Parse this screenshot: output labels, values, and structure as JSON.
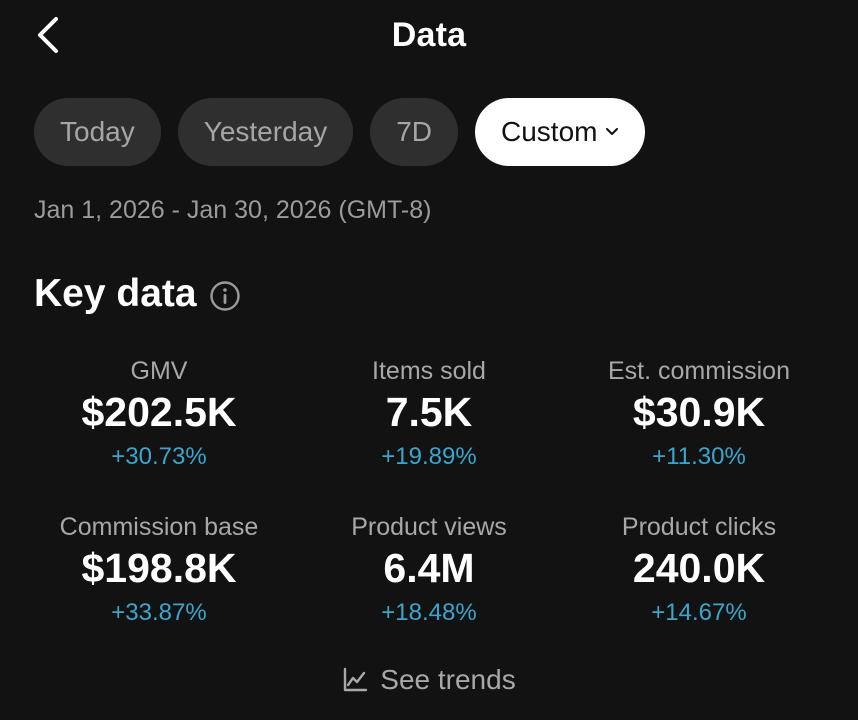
{
  "header": {
    "title": "Data",
    "back_icon": "chevron-left-icon"
  },
  "tabs": [
    {
      "label": "Today",
      "active": false
    },
    {
      "label": "Yesterday",
      "active": false
    },
    {
      "label": "7D",
      "active": false
    },
    {
      "label": "Custom",
      "active": true,
      "icon": "chevron-down-icon"
    }
  ],
  "date_range": "Jan 1, 2026 - Jan 30, 2026 (GMT-8)",
  "key_data": {
    "title": "Key data",
    "info_icon": "info-circle-icon",
    "metrics": [
      {
        "label": "GMV",
        "value": "$202.5K",
        "change": "+30.73%"
      },
      {
        "label": "Items sold",
        "value": "7.5K",
        "change": "+19.89%"
      },
      {
        "label": "Est. commission",
        "value": "$30.9K",
        "change": "+11.30%"
      },
      {
        "label": "Commission base",
        "value": "$198.8K",
        "change": "+33.87%"
      },
      {
        "label": "Product views",
        "value": "6.4M",
        "change": "+18.48%"
      },
      {
        "label": "Product clicks",
        "value": "240.0K",
        "change": "+14.67%"
      }
    ]
  },
  "see_trends": {
    "label": "See trends",
    "icon": "trend-chart-icon"
  },
  "colors": {
    "background": "#121212",
    "tab_inactive": "#2f2f2f",
    "tab_active": "#ffffff",
    "positive_change": "#3aa6cc"
  }
}
